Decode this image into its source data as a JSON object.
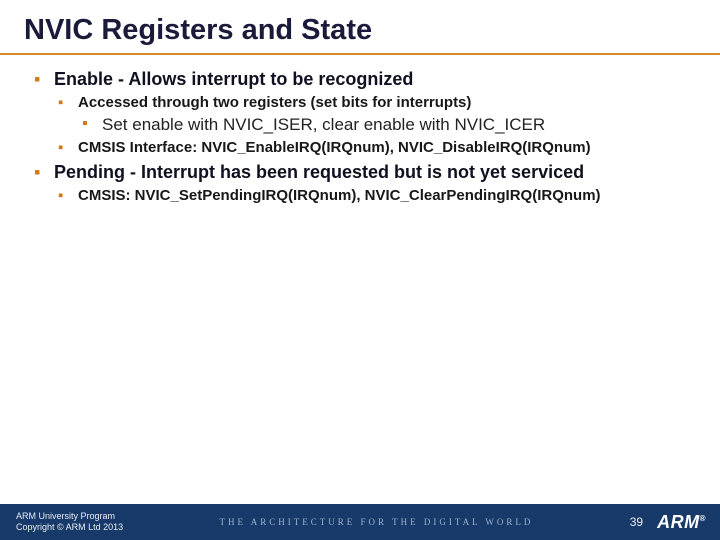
{
  "title": "NVIC Registers and State",
  "bullets": {
    "b1": "Enable - Allows interrupt to be recognized",
    "b1_1": "Accessed through two registers (set bits for interrupts)",
    "b1_1_1": "Set enable with NVIC_ISER, clear enable with NVIC_ICER",
    "b1_2": "CMSIS Interface: NVIC_EnableIRQ(IRQnum), NVIC_DisableIRQ(IRQnum)",
    "b2": "Pending - Interrupt has been requested but is not yet serviced",
    "b2_1": "CMSIS: NVIC_SetPendingIRQ(IRQnum), NVIC_ClearPendingIRQ(IRQnum)"
  },
  "footer": {
    "line1": "ARM University Program",
    "line2": "Copyright © ARM Ltd 2013",
    "tagline": "THE ARCHITECTURE FOR THE DIGITAL WORLD",
    "page": "39",
    "logo": "ARM",
    "reg": "®"
  }
}
